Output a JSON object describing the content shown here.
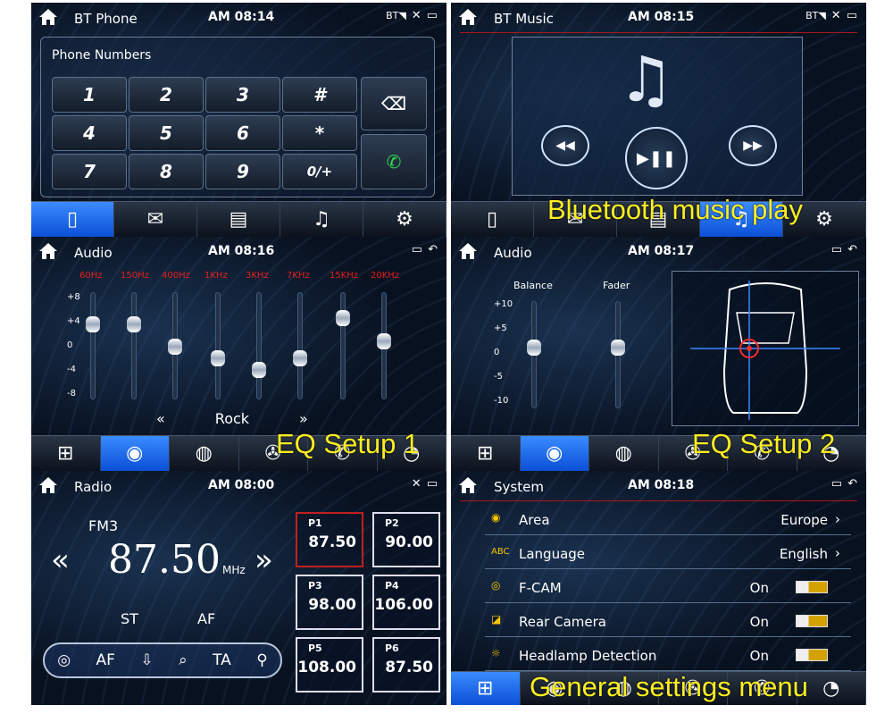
{
  "bt_phone": {
    "title": "BT Phone",
    "time": "AM 08:14",
    "section_label": "Phone Numbers",
    "keys": [
      "1",
      "2",
      "3",
      "#",
      "4",
      "5",
      "6",
      "*",
      "7",
      "8",
      "9",
      "0/+"
    ],
    "status_icons": [
      "bluetooth-signal-icon",
      "tools-icon",
      "screen-icon"
    ],
    "tabs": [
      "phone-icon",
      "call-log-icon",
      "phonebook-icon",
      "music-icon",
      "settings-icon"
    ]
  },
  "bt_music": {
    "title": "BT Music",
    "time": "AM 08:15",
    "overlay": "Bluetooth music play",
    "controls": [
      "previous-icon",
      "play-pause-icon",
      "next-icon"
    ]
  },
  "eq": {
    "title": "Audio",
    "time": "AM 08:16",
    "overlay": "EQ Setup 1",
    "freqs": [
      "60Hz",
      "150Hz",
      "400Hz",
      "1KHz",
      "3KHz",
      "7KHz",
      "15KHz",
      "20KHz"
    ],
    "scale": [
      "+8",
      "+4",
      "0",
      "-4",
      "-8"
    ],
    "levels": [
      4,
      4,
      0,
      -2,
      -4,
      -2,
      5,
      1
    ],
    "preset": "Rock",
    "prev": "«",
    "next": "»"
  },
  "balance": {
    "title": "Audio",
    "time": "AM 08:17",
    "overlay": "EQ Setup 2",
    "balance_label": "Balance",
    "fader_label": "Fader",
    "scale": [
      "+10",
      "+5",
      "0",
      "-5",
      "-10"
    ]
  },
  "radio": {
    "title": "Radio",
    "time": "AM 08:00",
    "band": "FM3",
    "frequency": "87.50",
    "unit": "MHz",
    "stereo": "ST",
    "af": "AF",
    "prev": "«",
    "next": "»",
    "presets": [
      {
        "label": "P1",
        "value": "87.50"
      },
      {
        "label": "P2",
        "value": "90.00"
      },
      {
        "label": "P3",
        "value": "98.00"
      },
      {
        "label": "P4",
        "value": "106.00"
      },
      {
        "label": "P5",
        "value": "108.00"
      },
      {
        "label": "P6",
        "value": "87.50"
      }
    ],
    "controls": {
      "af": "AF",
      "ta": "TA"
    }
  },
  "system": {
    "title": "System",
    "time": "AM 08:18",
    "overlay": "General settings menu",
    "rows": [
      {
        "label": "Area",
        "value": "Europe"
      },
      {
        "label": "Language",
        "value": "English",
        "icon": "ABC"
      },
      {
        "label": "F-CAM",
        "value": "On"
      },
      {
        "label": "Rear Camera",
        "value": "On"
      },
      {
        "label": "Headlamp Detection",
        "value": "On"
      }
    ]
  }
}
